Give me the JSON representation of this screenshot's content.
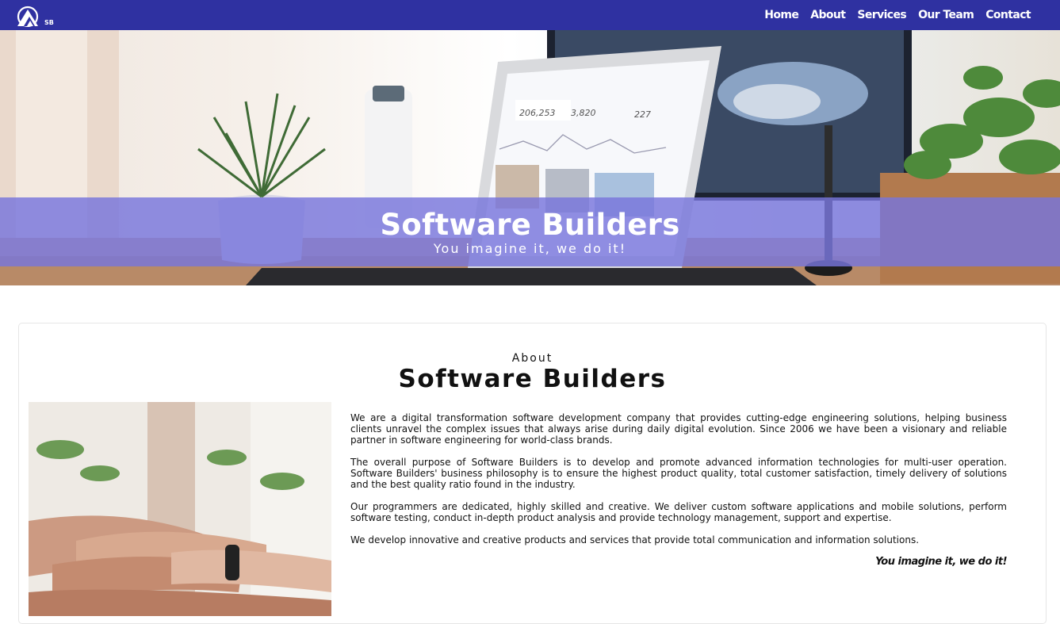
{
  "brand": {
    "logo_text": "SB"
  },
  "nav": {
    "items": [
      {
        "label": "Home"
      },
      {
        "label": "About"
      },
      {
        "label": "Services"
      },
      {
        "label": "Our Team"
      },
      {
        "label": "Contact"
      }
    ]
  },
  "hero": {
    "title": "Software Builders",
    "subtitle": "You imagine it, we do it!",
    "screen_stats": [
      "206,253",
      "3,820",
      "227"
    ]
  },
  "about": {
    "eyebrow": "About",
    "title": "Software Builders",
    "paragraphs": [
      "We are a digital transformation software development company that provides cutting-edge engineering solutions, helping business clients unravel the complex issues that always arise during daily digital evolution. Since 2006 we have been a visionary and reliable partner in software engineering for world-class brands.",
      "The overall purpose of Software Builders is to develop and promote advanced information technologies for multi-user operation. Software Builders' business philosophy is to ensure the highest product quality, total customer satisfaction, timely delivery of solutions and the best quality ratio found in the industry.",
      "Our programmers are dedicated, highly skilled and creative. We deliver custom software applications and mobile solutions, perform software testing, conduct in-depth product analysis and provide technology management, support and expertise.",
      "We develop innovative and creative products and services that provide total communication and information solutions."
    ],
    "tagline": "You imagine it, we do it!"
  },
  "colors": {
    "navbar": "#2f31a1",
    "hero_band": "#7875dc",
    "text": "#111111"
  },
  "icons": {
    "logo": "sb-mountain-logo-icon"
  }
}
